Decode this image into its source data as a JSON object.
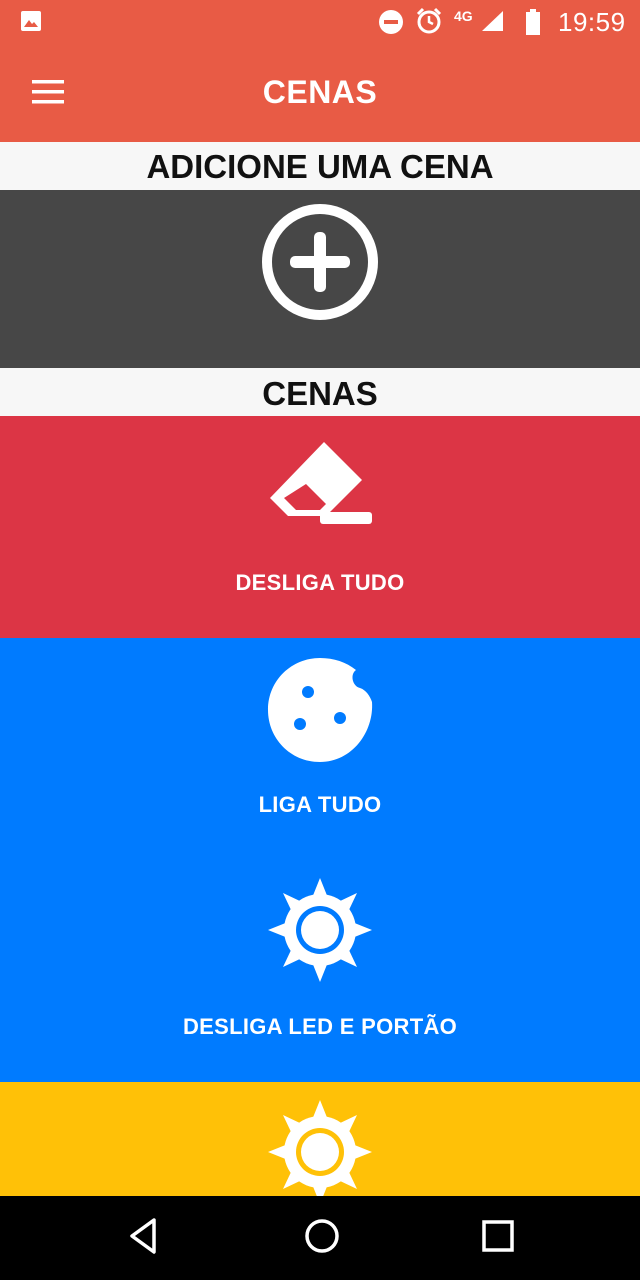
{
  "status_bar": {
    "time": "19:59",
    "network": "4G",
    "icons": [
      "gallery-icon",
      "do-not-disturb-icon",
      "alarm-icon",
      "signal-icon",
      "battery-icon"
    ]
  },
  "app_bar": {
    "title": "CENAS",
    "menu_icon": "hamburger-menu-icon",
    "color": "#e85b45"
  },
  "add_section": {
    "label": "ADICIONE UMA CENA",
    "icon": "add-circle-icon",
    "color": "#474747"
  },
  "scenes_section": {
    "label": "CENAS",
    "items": [
      {
        "label": "DESLIGA TUDO",
        "icon": "eraser-icon",
        "color": "#dc3545"
      },
      {
        "label": "LIGA TUDO",
        "icon": "cookie-icon",
        "color": "#007bff"
      },
      {
        "label": "DESLIGA LED E PORTÃO",
        "icon": "sun-icon",
        "color": "#007bff"
      },
      {
        "label": "",
        "icon": "sun-icon",
        "color": "#ffc107"
      }
    ]
  },
  "nav_bar": {
    "icons": [
      "back-icon",
      "home-icon",
      "recents-icon"
    ]
  }
}
